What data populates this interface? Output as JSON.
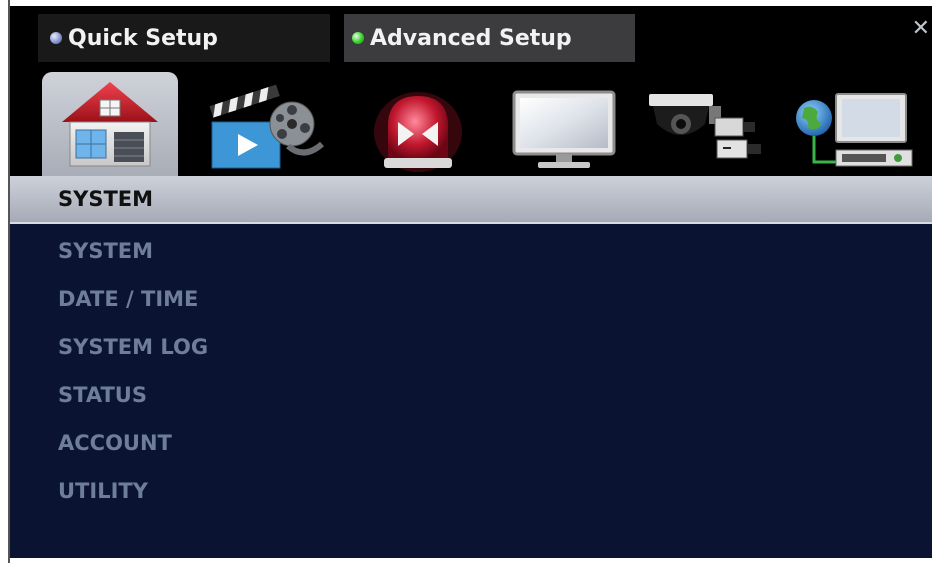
{
  "tabs": [
    {
      "label": "Quick Setup",
      "status_color": "#7f8fc8",
      "selected": false
    },
    {
      "label": "Advanced Setup",
      "status_color": "#37d12c",
      "selected": true
    }
  ],
  "close_label": "✕",
  "category_icons": [
    {
      "name": "system-house-icon",
      "selected": true
    },
    {
      "name": "record-clapper-film-icon",
      "selected": false
    },
    {
      "name": "event-alarm-light-icon",
      "selected": false
    },
    {
      "name": "display-monitor-icon",
      "selected": false
    },
    {
      "name": "camera-icon",
      "selected": false
    },
    {
      "name": "network-computer-icon",
      "selected": false
    }
  ],
  "section": {
    "title": "SYSTEM"
  },
  "menu": {
    "items": [
      "SYSTEM",
      "DATE / TIME",
      "SYSTEM LOG",
      "STATUS",
      "ACCOUNT",
      "UTILITY"
    ]
  },
  "colors": {
    "panel": "#0a1432",
    "section_bar": "#b9bdc7",
    "menu_text": "#6e7d98"
  }
}
